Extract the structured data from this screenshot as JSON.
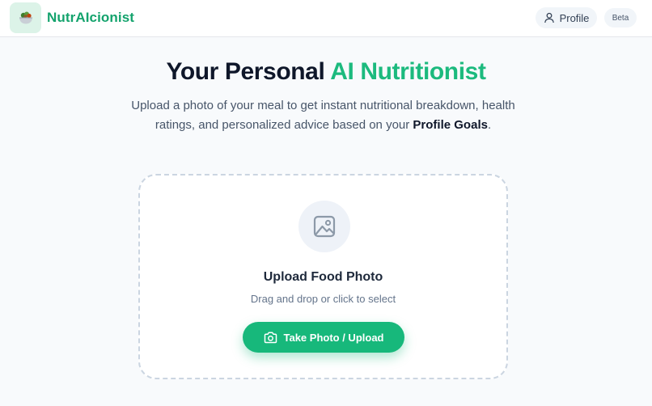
{
  "header": {
    "brand": "NutrAIcionist",
    "profile_label": "Profile",
    "beta_label": "Beta",
    "logo_icon": "salad-bowl-icon",
    "profile_icon": "user-icon"
  },
  "hero": {
    "title_main": "Your Personal ",
    "title_accent": "AI Nutritionist",
    "subtitle_pre": "Upload a photo of your meal to get instant nutritional breakdown, health ratings, and personalized advice based on your ",
    "subtitle_strong": "Profile Goals",
    "subtitle_post": "."
  },
  "upload": {
    "icon": "image-icon",
    "title": "Upload Food Photo",
    "hint": "Drag and drop or click to select",
    "button_label": "Take Photo / Upload",
    "button_icon": "camera-icon"
  },
  "colors": {
    "accent": "#17b87b",
    "brand_text": "#14a36d",
    "title_accent": "#1cba7e"
  }
}
